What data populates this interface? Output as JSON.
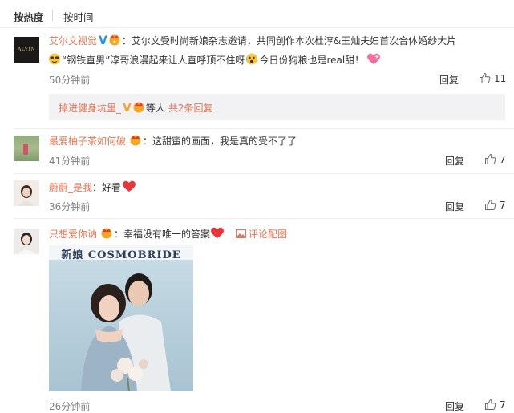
{
  "sort": {
    "hot": "按热度",
    "time": "按时间"
  },
  "comments": [
    {
      "name": "艾尔文视觉",
      "verified": "V",
      "text_line1": "：艾尔文受时尚新娘杂志邀请，共同创作本次杜淳&王灿夫妇首次合体婚纱大片",
      "text_line2_a": "“钢铁直男”淳哥浪漫起来让人直呼顶不住呀",
      "text_line2_b": "今日份狗粮也是real甜！",
      "avatar_text": "ALVIN",
      "time": "50分钟前",
      "reply": "回复",
      "likes": "11"
    },
    {
      "name": "最爱柚子茶如何破",
      "text": "：这甜蜜的画面，我是真的受不了了",
      "time": "41分钟前",
      "reply": "回复",
      "likes": "7"
    },
    {
      "name": "蔚蔚_是我",
      "text": "：好看",
      "time": "36分钟前",
      "reply": "回复",
      "likes": "7"
    },
    {
      "name": "只想爱你讷",
      "text": "：幸福没有唯一的答案",
      "pic_link": "评论配图",
      "photo_header": "新娘 COSMOBRIDE",
      "time": "26分钟前",
      "reply": "回复",
      "likes": "7"
    }
  ],
  "sub_replies": {
    "name": "掉进健身坑里_",
    "verified": "V",
    "suffix": "等人",
    "count": "共2条回复"
  },
  "colors": {
    "name": "#eb7350",
    "verified": "#1e90ff",
    "heart": "#e8363a",
    "subbox": "#f2f2f5"
  },
  "icons": [
    "thumbs-up-icon",
    "verified-v-icon",
    "heart-icon",
    "crown-badge-icon",
    "image-icon"
  ]
}
